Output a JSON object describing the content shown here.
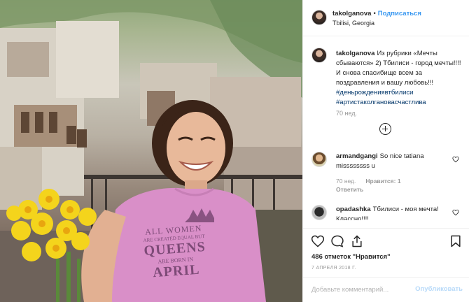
{
  "post": {
    "username": "takolganova",
    "follow_label": "Подписаться",
    "location": "Tbilisi, Georgia",
    "photo": {
      "shirt_text": [
        "ALL WOMEN",
        "ARE CREATED EQUAL BUT",
        "QUEENS",
        "ARE BORN IN",
        "APRIL"
      ]
    }
  },
  "caption": {
    "username": "takolganova",
    "text": "Из рубрики «Мечты сбываются» 2) Тбилиси - город мечты!!!! И снова спасибище всем за поздравления и вашу любовь!!!",
    "hashtags": [
      "#деньрождениявтбилиси",
      "#артистаколгановасчастлива"
    ],
    "time": "70 нед."
  },
  "comments": [
    {
      "username": "armandgangi",
      "text": "So nice tatiana missssssss u",
      "time": "70 нед.",
      "likes": "Нравится: 1",
      "reply_label": "Ответить"
    },
    {
      "username": "opadashka",
      "text": "Тбилиси - моя мечта! Классно!!!!"
    }
  ],
  "likes_text": "486 отметок \"Нравится\"",
  "date": "7 АПРЕЛЯ 2018 Г.",
  "add_comment": {
    "placeholder": "Добавьте комментарий...",
    "button_label": "Опубликовать"
  },
  "icons": {
    "load_more": "plus-circle-icon",
    "like": "heart-icon",
    "comment": "comment-bubble-icon",
    "share": "share-icon",
    "save": "bookmark-icon"
  },
  "colors": {
    "link_blue": "#3897f0",
    "hashtag": "#003569",
    "muted": "#999999",
    "shirt_pink": "#d98fc8"
  }
}
